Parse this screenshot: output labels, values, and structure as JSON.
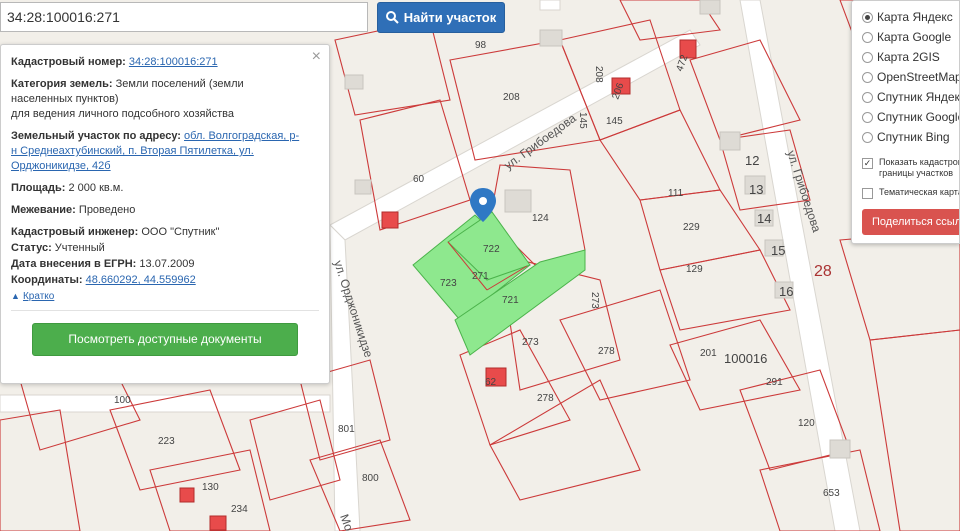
{
  "search": {
    "value": "34:28:100016:271",
    "button_label": "Найти участок"
  },
  "info": {
    "cadastral_label": "Кадастровый номер:",
    "cadastral_value": "34:28:100016:271",
    "category_label": "Категория земель:",
    "category_value_1": "Земли поселений (земли",
    "category_value_2": "населенных пунктов)",
    "category_value_3": "для ведения личного подсобного хозяйства",
    "address_label": "Земельный участок по адресу:",
    "address_part_1": "обл. Волгоградская, р-",
    "address_part_2": "н Среднеахтубинский, п. Вторая Пятилетка, ул.",
    "address_part_3": "Орджоникидзе, 42б",
    "area_label": "Площадь:",
    "area_value": "2 000 кв.м.",
    "survey_label": "Межевание:",
    "survey_value": "Проведено",
    "engineer_label": "Кадастровый инженер:",
    "engineer_value": "ООО \"Спутник\"",
    "status_label": "Статус:",
    "status_value": "Учтенный",
    "egrn_label": "Дата внесения в ЕГРН:",
    "egrn_value": "13.07.2009",
    "coords_label": "Координаты:",
    "coords_value": "48.660292, 44.559962",
    "collapse_label": "Кратко",
    "docs_button": "Посмотреть доступные документы"
  },
  "layers": {
    "options": [
      "Карта Яндекс",
      "Карта Google",
      "Карта 2GIS",
      "OpenStreetMap",
      "Спутник Яндекс",
      "Спутник Google",
      "Спутник Bing"
    ],
    "selected_index": 0,
    "show_borders_1": "Показать кадастровые",
    "show_borders_2": "границы участков",
    "thematic": "Тематическая карта",
    "share_button": "Поделиться ссылкой"
  },
  "map": {
    "streets": {
      "griboedova_1": "ул. Грибоедова",
      "griboedova_2": "ул. Грибоедова",
      "ordzhonikidze": "ул. Орджоникидзе",
      "bottom": "Мо"
    },
    "plot_numbers": [
      "98",
      "208",
      "206",
      "145",
      "111",
      "229",
      "129",
      "201",
      "291",
      "120",
      "653",
      "124",
      "722",
      "271",
      "723",
      "721",
      "273",
      "273",
      "278",
      "278",
      "60",
      "100",
      "223",
      "130",
      "234",
      "801",
      "800",
      "12",
      "13",
      "14",
      "15",
      "16",
      "472",
      "208",
      "145",
      "62"
    ],
    "quarter_labels": {
      "q1": "100016",
      "q2": "28"
    },
    "accent_colors": {
      "selected_fill": "#8ee88e",
      "boundary": "#cc3a3a",
      "marker": "#2f78c4",
      "building": "#e84b4b"
    }
  }
}
